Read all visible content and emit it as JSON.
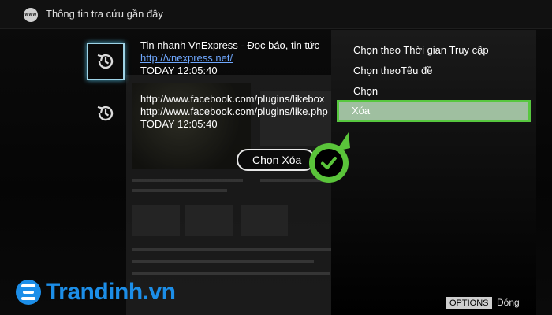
{
  "header": {
    "icon": "www-icon",
    "icon_text": "www",
    "title": "Thông tin tra cứu gần đây"
  },
  "entries": [
    {
      "icon": "history-icon",
      "title": "Tin nhanh VnExpress - Đọc báo, tin tức",
      "url": "http://vnexpress.net/",
      "time": "TODAY  12:05:40",
      "selected": true
    },
    {
      "icon": "history-icon",
      "title": "http://www.facebook.com/plugins/likebox",
      "url": "http://www.facebook.com/plugins/like.php",
      "time": "TODAY  12:05:40",
      "selected": false
    }
  ],
  "menu": {
    "items": [
      {
        "label": "Chọn theo Thời gian Truy cập"
      },
      {
        "label": "Chọn theoTêu đề"
      },
      {
        "label": "Chọn"
      },
      {
        "label": "Xóa",
        "active": true
      }
    ]
  },
  "pill": {
    "label": "Chọn Xóa"
  },
  "footer": {
    "options_key": "OPTIONS",
    "options_label": "Đóng"
  },
  "logo": {
    "text": "Trandinh.vn"
  },
  "colors": {
    "accent_green": "#57c73f",
    "link_blue": "#6fa8ff",
    "brand_blue": "#1c8ee8",
    "highlight_bg": "#9fbfa0"
  }
}
